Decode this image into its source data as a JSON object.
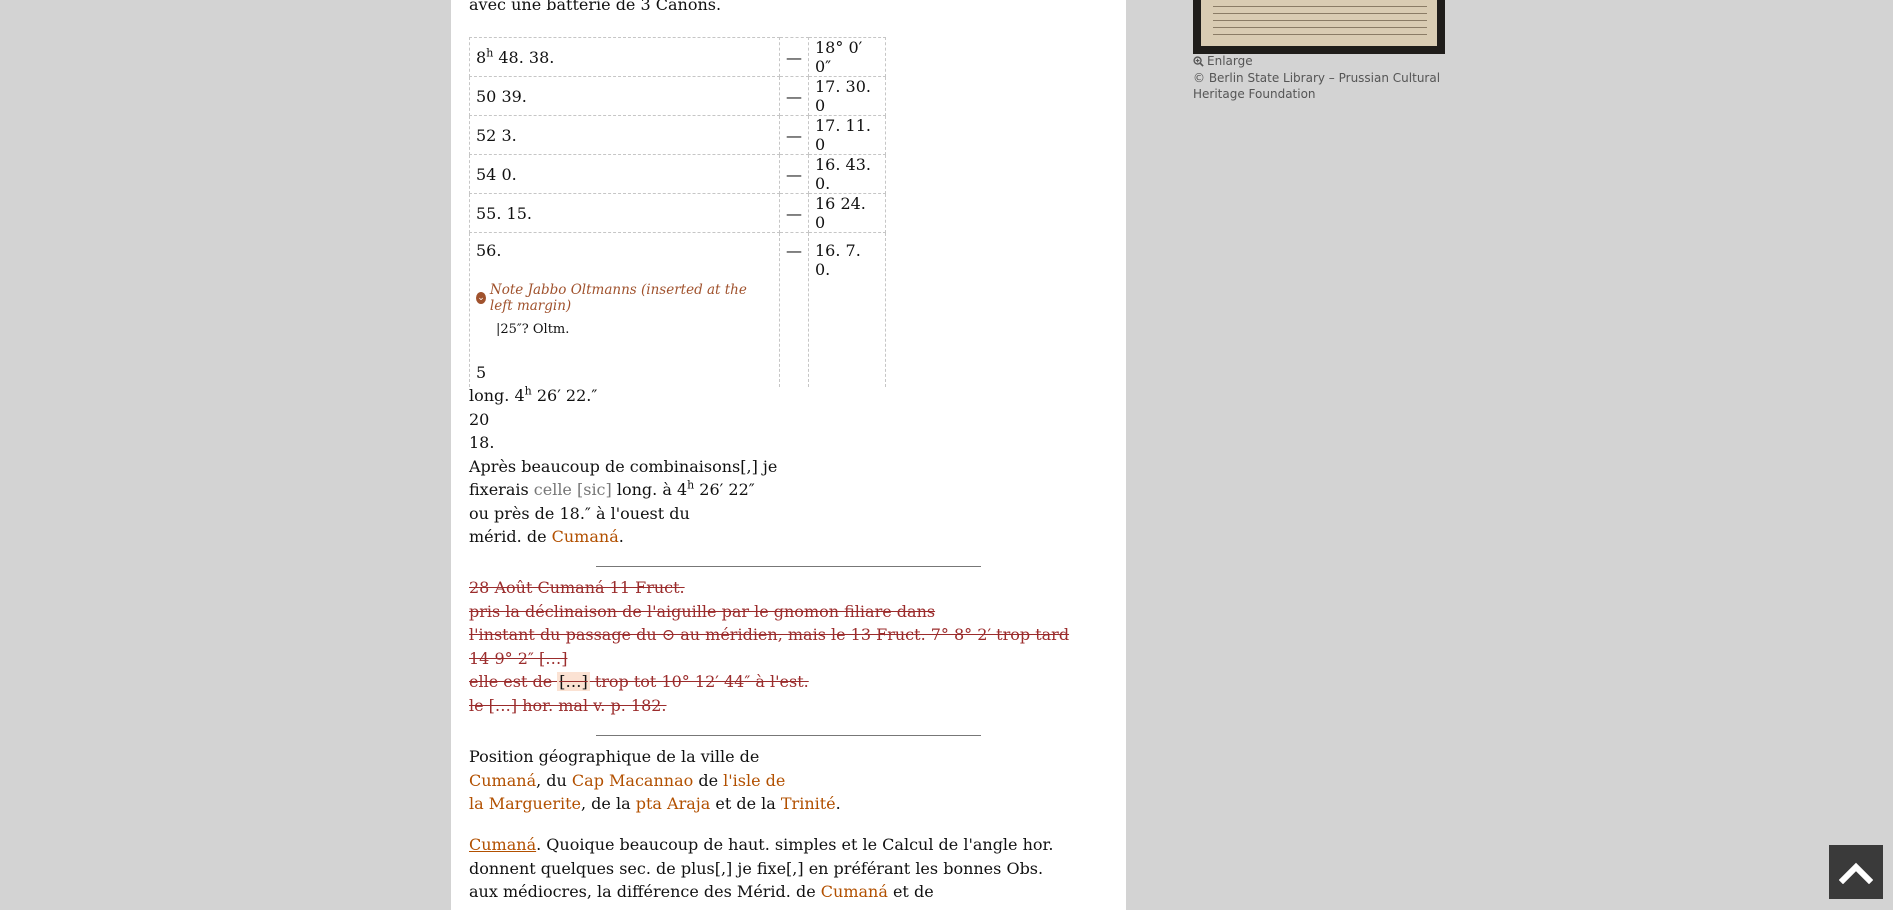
{
  "top_text": "avec une batterie de 3 Canons.",
  "table": {
    "rows": [
      {
        "time_h": "8",
        "time_rest": " 48. 38.",
        "dash": "—",
        "value": "18° 0′ 0″"
      },
      {
        "time": "50 39.",
        "dash": "—",
        "value": "17. 30. 0"
      },
      {
        "time": "52 3.",
        "dash": "—",
        "value": "17. 11. 0"
      },
      {
        "time": "54 0.",
        "dash": "—",
        "value": "16. 43. 0."
      },
      {
        "time": "55. 15.",
        "dash": "—",
        "value": "16 24. 0"
      },
      {
        "time": "56.",
        "dash": "—",
        "value": "16. 7. 0."
      }
    ],
    "note_label": "Note Jabbo Oltmanns (inserted at the left margin)",
    "note_text": "|25″? Oltm.",
    "last_cell": "5"
  },
  "calc": {
    "line1_a": "long. 4",
    "line1_sup": "h",
    "line1_b": " 26′ 22.″",
    "line2": "20",
    "line3": "18.",
    "line4": "Après beaucoup de combinaisons[,] je",
    "line5_a": "fixerais ",
    "line5_sic": "celle [sic]",
    "line5_b": " long. à 4",
    "line5_sup": "h",
    "line5_c": " 26′ 22″",
    "line6": "ou près de 18.″ à l'ouest du",
    "line7_a": "mérid. de ",
    "line7_link": "Cumaná",
    "line7_b": "."
  },
  "struck": {
    "l1": "28 Août Cumaná 11 Fruct.",
    "l2": "pris la déclinaison de l'aiguille par le gnomon filiare dans",
    "l3": "l'instant du passage du ⊙ au méridien, mais le 13 Fruct. 7° 8° 2′ trop tard",
    "l4": "14 9° 2″ […]",
    "l5_a": "elle est de ",
    "l5_gap": "[…]",
    "l5_b": " trop tot 10° 12′ 44″ à l'est.",
    "l6": "le […] hor. mal v. p. 182."
  },
  "position": {
    "l1": "Position géographique de la ville de",
    "cumana": "Cumaná",
    "du": ", du ",
    "cap": "Cap Macannao",
    "de": " de ",
    "isle1": "l'isle de",
    "isle2": "la Marguerite",
    "dela": ", de la ",
    "pta": "pta Araja",
    "etdela": " et de la ",
    "trinite": "Trinité",
    "end": "."
  },
  "para": {
    "link1": "Cumaná",
    "l1": ". Quoique beaucoup de haut. simples et le Calcul de l'angle hor.",
    "l2": "donnent quelques sec. de plus[,] je fixe[,] en préférant les bonnes Obs.",
    "l3_a": "aux médiocres, la différence des Mérid. de ",
    "l3_link": "Cumaná",
    "l3_b": " et de"
  },
  "image_caption": {
    "enlarge": "Enlarge",
    "credit": "© Berlin State Library – Prussian Cultural Heritage Foundation"
  },
  "icons": {
    "enlarge": "magnifier-plus-icon",
    "note": "chevron-down-circle-icon",
    "scroll": "arrow-up-icon"
  }
}
